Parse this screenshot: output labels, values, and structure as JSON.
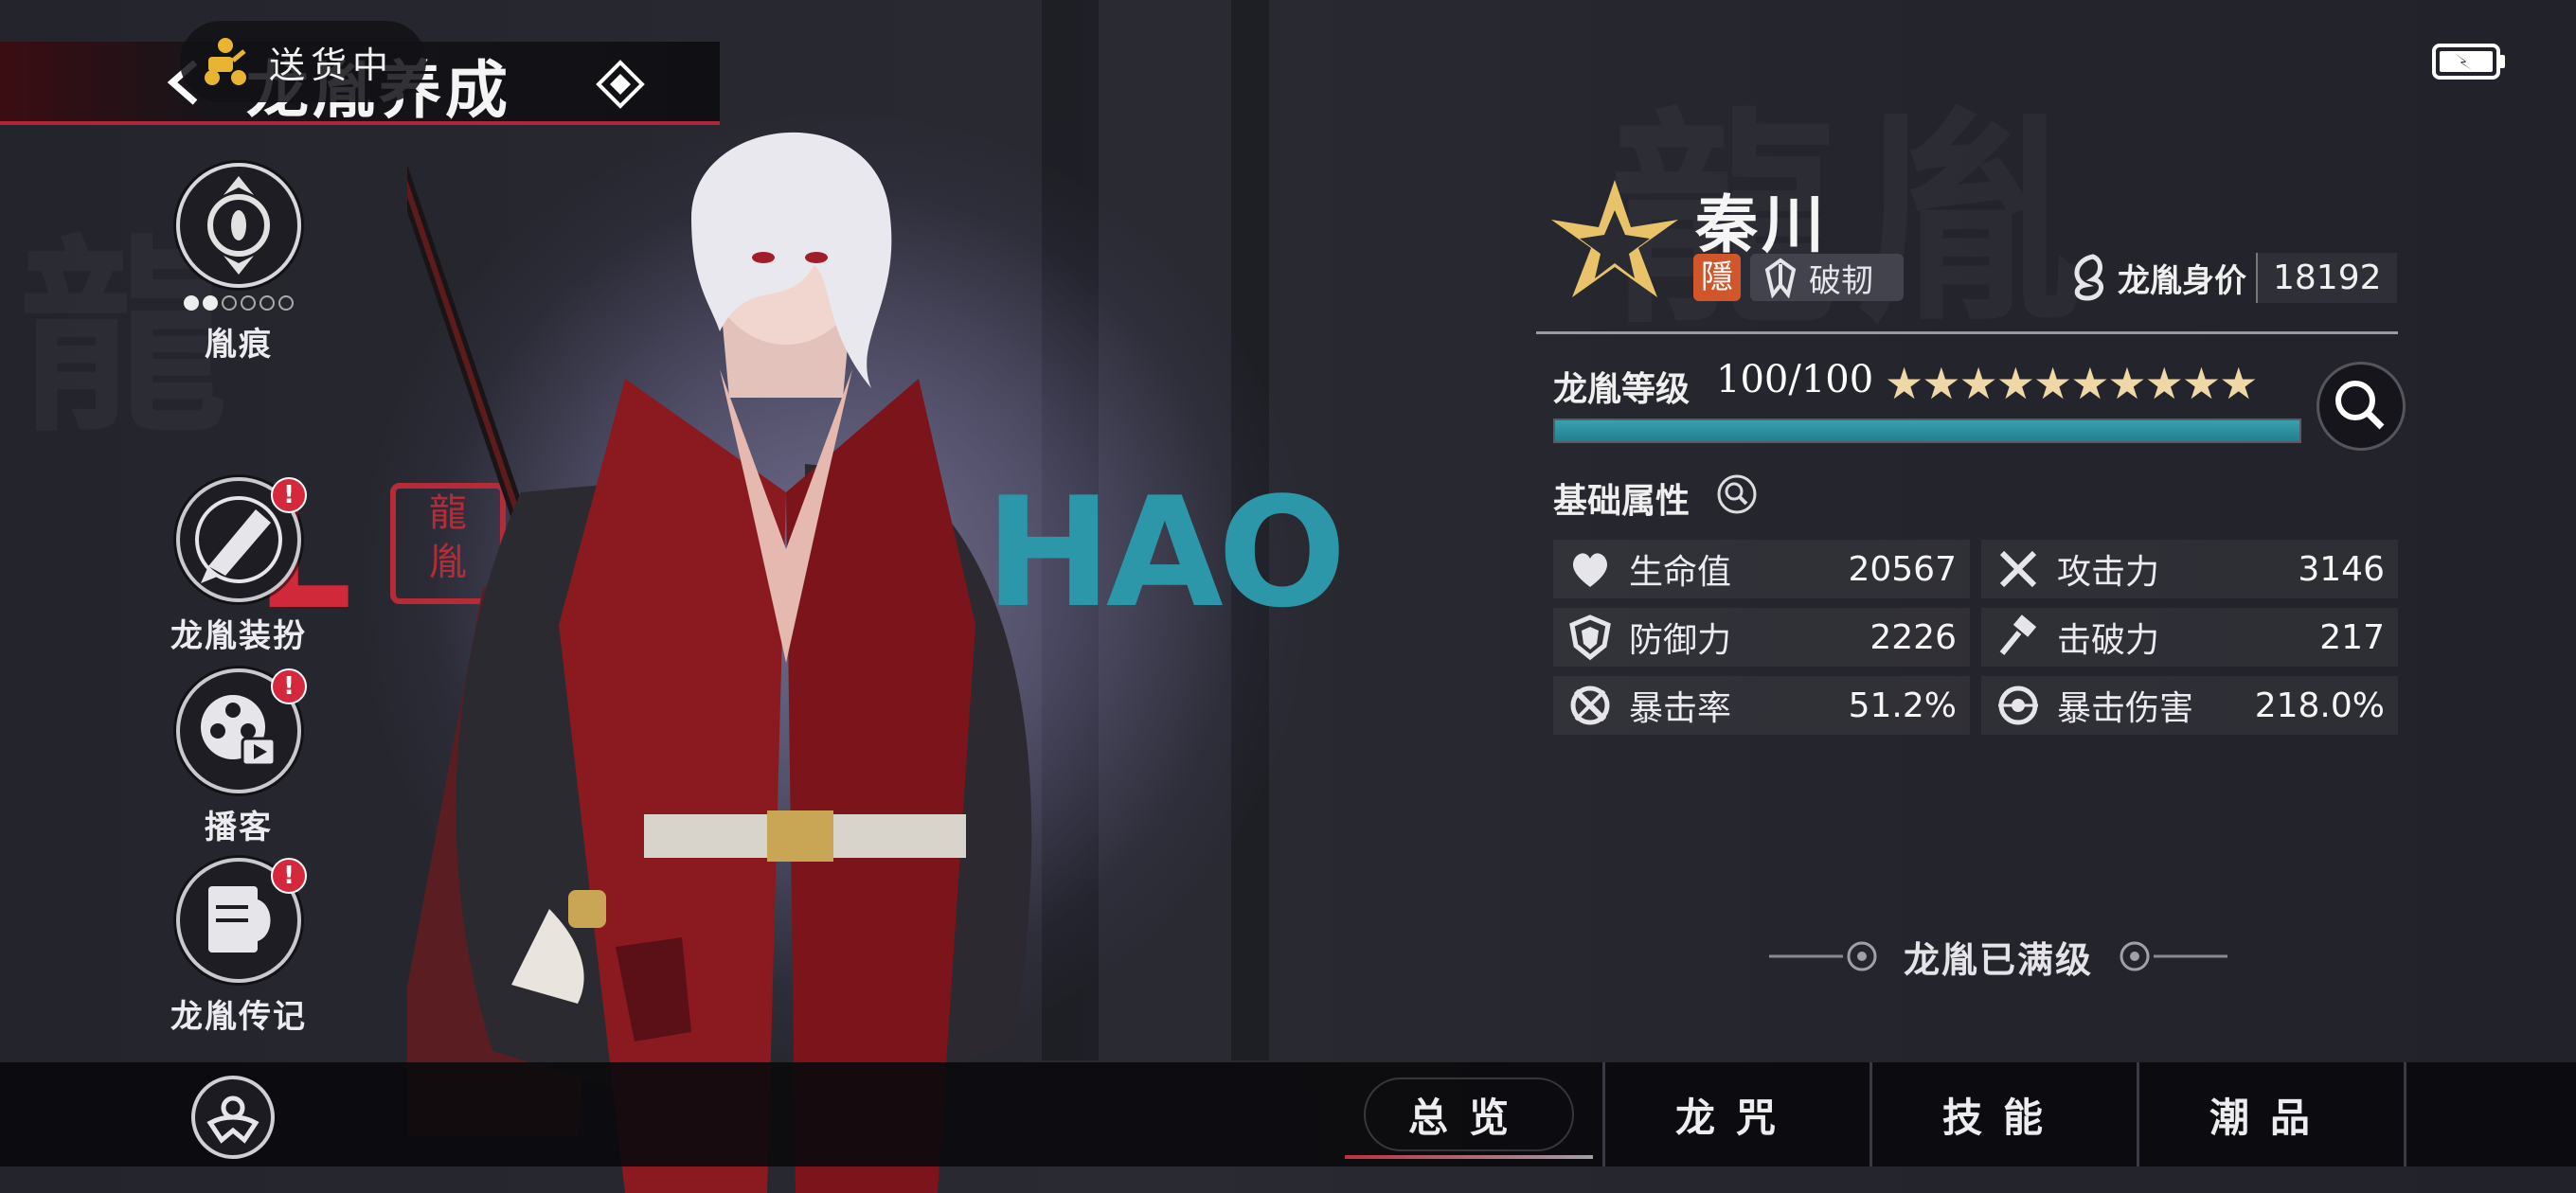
{
  "header": {
    "title": "龙胤养成",
    "delivery_status": "送货中"
  },
  "left_nav": [
    {
      "label": "胤痕",
      "badge": "",
      "dots_filled": 2,
      "dots_total": 6
    },
    {
      "label": "龙胤装扮",
      "badge": "!"
    },
    {
      "label": "播客",
      "badge": "!"
    },
    {
      "label": "龙胤传记",
      "badge": "!"
    }
  ],
  "character": {
    "name": "秦川",
    "faction_glyph": "隱",
    "type": "破韧",
    "worth_label": "龙胤身价",
    "worth_value": "18192",
    "level_label": "龙胤等级",
    "level_value": "100/100",
    "stars": "★★★★★★★★★★",
    "xp_progress": 1.0,
    "max_level_text": "龙胤已满级"
  },
  "stats": {
    "title": "基础属性",
    "items": [
      {
        "icon": "heart-icon",
        "name": "生命值",
        "value": "20567"
      },
      {
        "icon": "crossed-swords-icon",
        "name": "攻击力",
        "value": "3146"
      },
      {
        "icon": "shield-icon",
        "name": "防御力",
        "value": "2226"
      },
      {
        "icon": "hammer-icon",
        "name": "击破力",
        "value": "217"
      },
      {
        "icon": "crit-rate-icon",
        "name": "暴击率",
        "value": "51.2%"
      },
      {
        "icon": "crit-damage-icon",
        "name": "暴击伤害",
        "value": "218.0%"
      }
    ]
  },
  "bottom_tabs": [
    {
      "label": "总览",
      "active": true
    },
    {
      "label": "龙咒",
      "active": false
    },
    {
      "label": "技能",
      "active": false
    },
    {
      "label": "潮品",
      "active": false
    }
  ],
  "decor": {
    "logo_left": "L",
    "logo_right": "HAO"
  },
  "colors": {
    "accent_red": "#d0293a",
    "accent_teal": "#2c97a8",
    "gold": "#efd8a6"
  }
}
